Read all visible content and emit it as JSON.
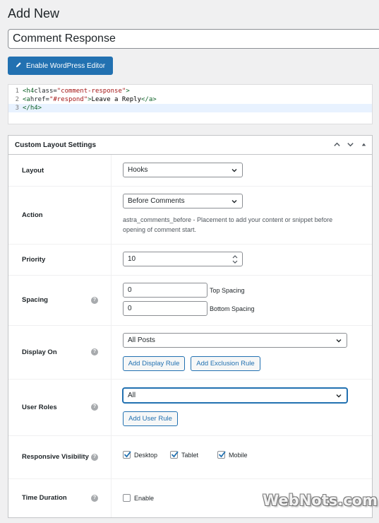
{
  "page": {
    "title": "Add New"
  },
  "post_title": {
    "value": "Comment Response"
  },
  "editor_button": {
    "label": "Enable WordPress Editor"
  },
  "code": {
    "lines": [
      {
        "number": "1",
        "parts": [
          [
            "tag",
            "<h4 "
          ],
          [
            "attr",
            "class="
          ],
          [
            "str",
            "\"comment-response\""
          ],
          [
            "tag",
            ">"
          ]
        ]
      },
      {
        "number": "2",
        "parts": [
          [
            "tag",
            "<a "
          ],
          [
            "attr",
            "href="
          ],
          [
            "str",
            "\"#respond\""
          ],
          [
            "tag",
            ">"
          ],
          [
            "txt",
            "Leave a Reply"
          ],
          [
            "tag",
            "</a>"
          ]
        ]
      },
      {
        "number": "3",
        "parts": [
          [
            "tag",
            "</h4>"
          ]
        ]
      }
    ]
  },
  "panel": {
    "title": "Custom Layout Settings",
    "rows": {
      "layout": {
        "label": "Layout",
        "value": "Hooks"
      },
      "action": {
        "label": "Action",
        "value": "Before Comments",
        "description_1": "astra_comments_before - Placement to add your content or snippet before",
        "description_2": "opening of comment start."
      },
      "priority": {
        "label": "Priority",
        "value": "10"
      },
      "spacing": {
        "label": "Spacing",
        "top_value": "0",
        "top_label": "Top Spacing",
        "bottom_value": "0",
        "bottom_label": "Bottom Spacing"
      },
      "display_on": {
        "label": "Display On",
        "value": "All Posts",
        "add_rule": "Add Display Rule",
        "add_exclusion": "Add Exclusion Rule"
      },
      "user_roles": {
        "label": "User Roles",
        "value": "All",
        "add_rule": "Add User Rule"
      },
      "responsive": {
        "label": "Responsive Visibility",
        "desktop": "Desktop",
        "tablet": "Tablet",
        "mobile": "Mobile",
        "desktop_checked": true,
        "tablet_checked": true,
        "mobile_checked": true
      },
      "time_duration": {
        "label": "Time Duration",
        "enable": "Enable",
        "enabled": false
      }
    },
    "help_glyph": "?"
  },
  "watermark": {
    "text": "WebNots.com"
  },
  "colors": {
    "primary": "#2271b1",
    "background": "#f0f0f1",
    "border": "#8c8f94"
  },
  "icons": {
    "edit": "pencil-icon",
    "collapse": "chevron-up-icon",
    "expand": "chevron-down-icon",
    "toggle": "triangle-up-icon"
  }
}
